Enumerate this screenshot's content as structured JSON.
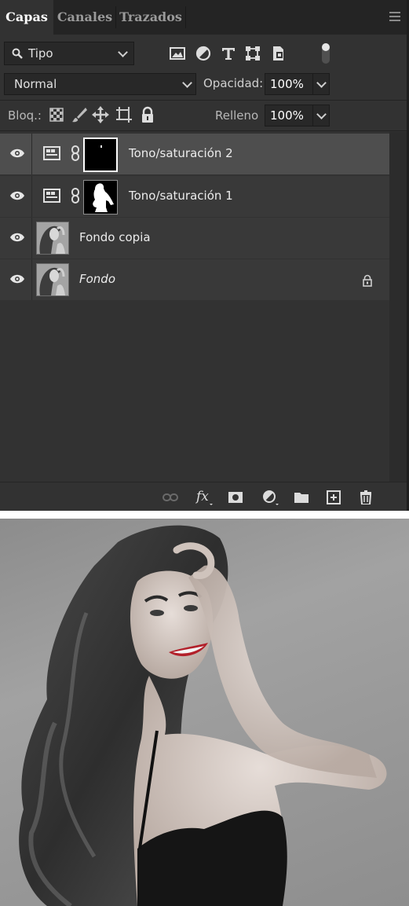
{
  "tabs": [
    {
      "label": "Capas",
      "active": true
    },
    {
      "label": "Canales",
      "active": false
    },
    {
      "label": "Trazados",
      "active": false
    }
  ],
  "filter": {
    "kind_label": "Tipo",
    "icons": [
      "pixel-filter-icon",
      "adjustment-filter-icon",
      "type-filter-icon",
      "shape-filter-icon",
      "smart-object-filter-icon"
    ]
  },
  "blend": {
    "mode": "Normal",
    "opacity_label": "Opacidad:",
    "opacity_value": "100%"
  },
  "lock": {
    "label": "Bloq.:",
    "icons": [
      "lock-transparent-icon",
      "lock-image-icon",
      "lock-position-icon",
      "lock-artboard-icon",
      "lock-all-icon"
    ],
    "fill_label": "Relleno",
    "fill_value": "100%"
  },
  "layers": [
    {
      "name": "Tono/saturación 2",
      "type": "adjustment",
      "selected": true,
      "visible": true,
      "italic": false,
      "locked": false
    },
    {
      "name": "Tono/saturación 1",
      "type": "adjustment",
      "selected": false,
      "visible": true,
      "italic": false,
      "locked": false
    },
    {
      "name": "Fondo copia",
      "type": "pixel",
      "selected": false,
      "visible": true,
      "italic": false,
      "locked": false
    },
    {
      "name": "Fondo",
      "type": "pixel",
      "selected": false,
      "visible": true,
      "italic": true,
      "locked": true
    }
  ],
  "footer_icons": [
    "link-layers-icon",
    "fx-icon",
    "add-mask-icon",
    "adjustment-layer-icon",
    "group-folder-icon",
    "new-layer-icon",
    "delete-icon"
  ],
  "colors": {
    "panel": "#323232",
    "tabbar": "#242424",
    "selected_row": "#4e4e4e",
    "row": "#393939"
  }
}
